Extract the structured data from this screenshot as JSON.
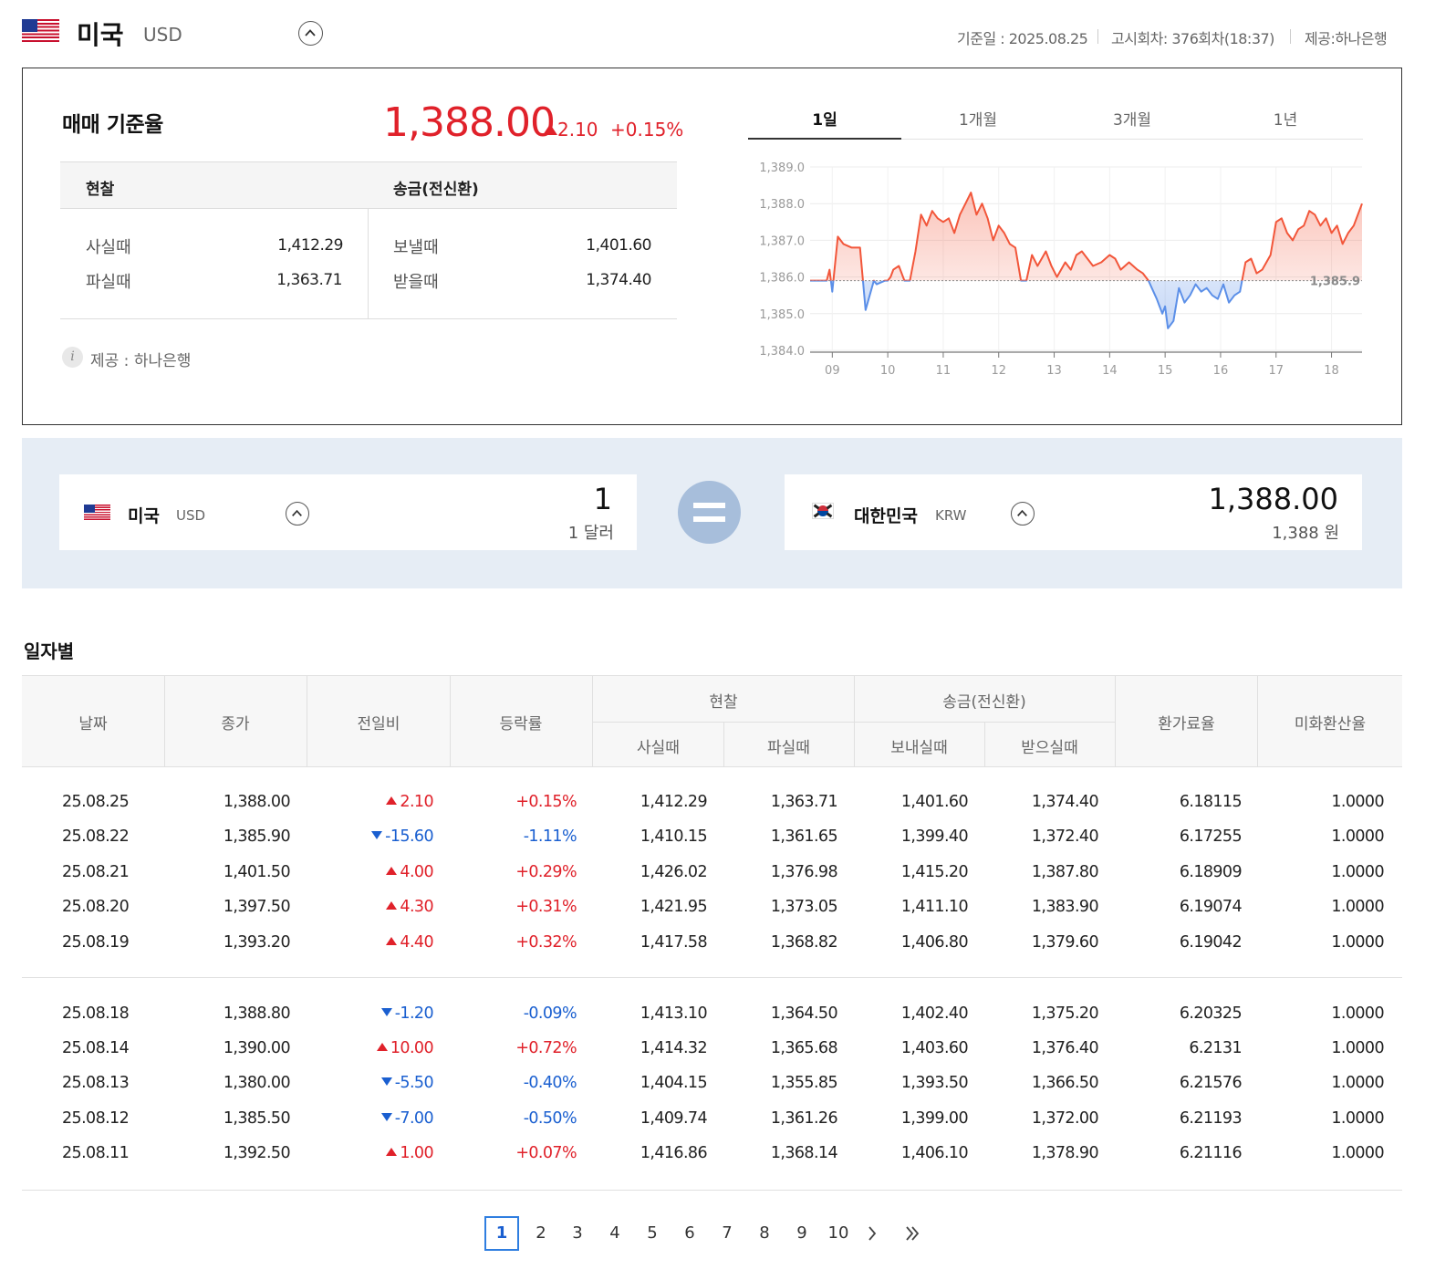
{
  "header": {
    "country": "미국",
    "code": "USD",
    "base_date": "기준일 : 2025.08.25",
    "notice_round": "고시회차: 376회차(18:37)",
    "provider": "제공:하나은행"
  },
  "summary": {
    "title": "매매 기준율",
    "rate": "1,388.00",
    "change": "2.10",
    "change_pct": "+0.15%",
    "cash_header": "현찰",
    "remit_header": "송금(전신환)",
    "cash_buy_label": "사실때",
    "cash_buy": "1,412.29",
    "cash_sell_label": "파실때",
    "cash_sell": "1,363.71",
    "remit_send_label": "보낼때",
    "remit_send": "1,401.60",
    "remit_receive_label": "받을때",
    "remit_receive": "1,374.40",
    "provider_note": "제공 : 하나은행"
  },
  "tabs": [
    "1일",
    "1개월",
    "3개월",
    "1년"
  ],
  "chart_data": {
    "type": "line",
    "title": "",
    "xlabel": "",
    "ylabel": "",
    "x_ticks": [
      "09",
      "10",
      "11",
      "12",
      "13",
      "14",
      "15",
      "16",
      "17",
      "18"
    ],
    "y_ticks": [
      "1,389.0",
      "1,388.0",
      "1,387.0",
      "1,386.0",
      "1,385.0",
      "1,384.0"
    ],
    "ylim": [
      1384.0,
      1389.0
    ],
    "xlim": [
      8.6,
      18.55
    ],
    "baseline": 1385.9,
    "baseline_label": "1,385.9",
    "colors": {
      "above": "#f2563a",
      "below": "#5b8fe8",
      "baseline": "#888888"
    },
    "series": [
      {
        "x": [
          8.6,
          8.9,
          8.95,
          9.0,
          9.1,
          9.2,
          9.35,
          9.5,
          9.6,
          9.75,
          9.8,
          9.95,
          10.0,
          10.05,
          10.1,
          10.2,
          10.3,
          10.4,
          10.5,
          10.6,
          10.7,
          10.8,
          10.9,
          11.0,
          11.1,
          11.2,
          11.3,
          11.4,
          11.5,
          11.6,
          11.7,
          11.8,
          11.9,
          12.0,
          12.1,
          12.2,
          12.3,
          12.4,
          12.5,
          12.6,
          12.7,
          12.85,
          12.95,
          13.05,
          13.2,
          13.3,
          13.4,
          13.5,
          13.6,
          13.7,
          13.85,
          14.0,
          14.1,
          14.2,
          14.35,
          14.5,
          14.6,
          14.7,
          14.85,
          14.95,
          15.0,
          15.05,
          15.15,
          15.25,
          15.35,
          15.45,
          15.55,
          15.65,
          15.75,
          15.85,
          15.95,
          16.05,
          16.15,
          16.25,
          16.35,
          16.45,
          16.55,
          16.65,
          16.75,
          16.9,
          17.0,
          17.1,
          17.2,
          17.3,
          17.4,
          17.5,
          17.6,
          17.7,
          17.8,
          17.9,
          18.0,
          18.1,
          18.2,
          18.3,
          18.4,
          18.55
        ],
        "values": [
          1385.9,
          1385.9,
          1386.2,
          1385.6,
          1387.1,
          1386.9,
          1386.8,
          1386.8,
          1385.1,
          1385.9,
          1385.8,
          1385.9,
          1385.9,
          1386.0,
          1386.2,
          1386.3,
          1385.9,
          1385.9,
          1386.7,
          1387.7,
          1387.4,
          1387.8,
          1387.6,
          1387.5,
          1387.6,
          1387.2,
          1387.7,
          1388.0,
          1388.3,
          1387.7,
          1388.0,
          1387.6,
          1387.0,
          1387.4,
          1387.2,
          1386.9,
          1386.8,
          1385.9,
          1385.9,
          1386.6,
          1386.3,
          1386.7,
          1386.3,
          1386.0,
          1386.4,
          1386.2,
          1386.6,
          1386.7,
          1386.5,
          1386.3,
          1386.4,
          1386.6,
          1386.5,
          1386.2,
          1386.4,
          1386.2,
          1386.1,
          1385.9,
          1385.4,
          1385.0,
          1385.2,
          1384.6,
          1384.8,
          1385.7,
          1385.3,
          1385.5,
          1385.8,
          1385.6,
          1385.7,
          1385.5,
          1385.4,
          1385.8,
          1385.3,
          1385.5,
          1385.6,
          1386.4,
          1386.5,
          1386.1,
          1386.2,
          1386.6,
          1387.5,
          1387.6,
          1387.2,
          1387.0,
          1387.3,
          1387.4,
          1387.8,
          1387.7,
          1387.4,
          1387.6,
          1387.2,
          1387.4,
          1386.9,
          1387.2,
          1387.4,
          1388.0
        ]
      }
    ]
  },
  "converter": {
    "from": {
      "country": "미국",
      "code": "USD",
      "amount": "1",
      "words": "1 달러"
    },
    "to": {
      "country": "대한민국",
      "code": "KRW",
      "amount": "1,388.00",
      "words": "1,388 원"
    }
  },
  "daily": {
    "title": "일자별",
    "columns": {
      "date": "날짜",
      "close": "종가",
      "change": "전일비",
      "change_pct": "등락률",
      "cash": "현찰",
      "cash_buy": "사실때",
      "cash_sell": "파실때",
      "remit": "송금(전신환)",
      "remit_send": "보내실때",
      "remit_receive": "받으실때",
      "fx_rate": "환가료율",
      "usd_rate": "미화환산율"
    },
    "rows": [
      [
        "25.08.25",
        "1,388.00",
        "up",
        "2.10",
        "+0.15%",
        "1,412.29",
        "1,363.71",
        "1,401.60",
        "1,374.40",
        "6.18115",
        "1.0000"
      ],
      [
        "25.08.22",
        "1,385.90",
        "down",
        "-15.60",
        "-1.11%",
        "1,410.15",
        "1,361.65",
        "1,399.40",
        "1,372.40",
        "6.17255",
        "1.0000"
      ],
      [
        "25.08.21",
        "1,401.50",
        "up",
        "4.00",
        "+0.29%",
        "1,426.02",
        "1,376.98",
        "1,415.20",
        "1,387.80",
        "6.18909",
        "1.0000"
      ],
      [
        "25.08.20",
        "1,397.50",
        "up",
        "4.30",
        "+0.31%",
        "1,421.95",
        "1,373.05",
        "1,411.10",
        "1,383.90",
        "6.19074",
        "1.0000"
      ],
      [
        "25.08.19",
        "1,393.20",
        "up",
        "4.40",
        "+0.32%",
        "1,417.58",
        "1,368.82",
        "1,406.80",
        "1,379.60",
        "6.19042",
        "1.0000"
      ],
      [
        "25.08.18",
        "1,388.80",
        "down",
        "-1.20",
        "-0.09%",
        "1,413.10",
        "1,364.50",
        "1,402.40",
        "1,375.20",
        "6.20325",
        "1.0000"
      ],
      [
        "25.08.14",
        "1,390.00",
        "up",
        "10.00",
        "+0.72%",
        "1,414.32",
        "1,365.68",
        "1,403.60",
        "1,376.40",
        "6.2131",
        "1.0000"
      ],
      [
        "25.08.13",
        "1,380.00",
        "down",
        "-5.50",
        "-0.40%",
        "1,404.15",
        "1,355.85",
        "1,393.50",
        "1,366.50",
        "6.21576",
        "1.0000"
      ],
      [
        "25.08.12",
        "1,385.50",
        "down",
        "-7.00",
        "-0.50%",
        "1,409.74",
        "1,361.26",
        "1,399.00",
        "1,372.00",
        "6.21193",
        "1.0000"
      ],
      [
        "25.08.11",
        "1,392.50",
        "up",
        "1.00",
        "+0.07%",
        "1,416.86",
        "1,368.14",
        "1,406.10",
        "1,378.90",
        "6.21116",
        "1.0000"
      ]
    ]
  },
  "pagination": {
    "pages": [
      "1",
      "2",
      "3",
      "4",
      "5",
      "6",
      "7",
      "8",
      "9",
      "10"
    ],
    "current": "1",
    "next_icon": "chevron-right-icon",
    "last_icon": "double-chevron-right-icon"
  }
}
